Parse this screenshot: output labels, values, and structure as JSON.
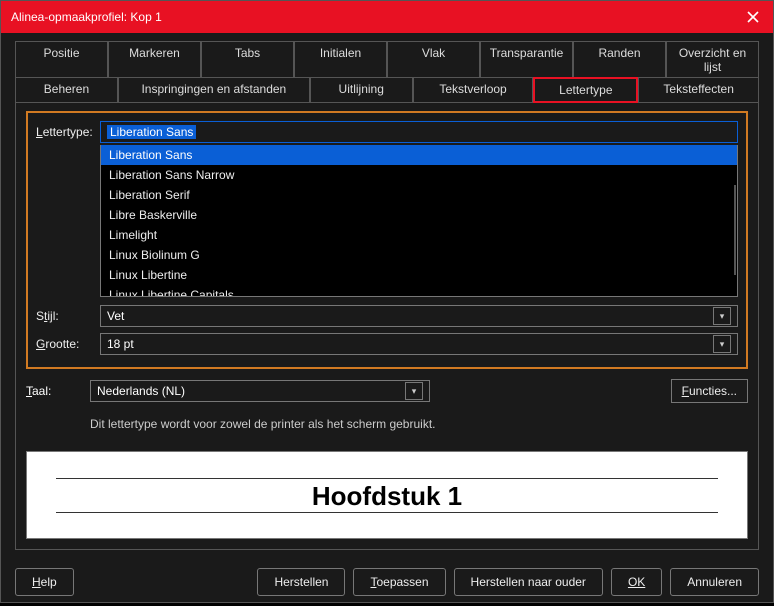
{
  "title": "Alinea-opmaakprofiel: Kop 1",
  "tabs1": {
    "positie": "Positie",
    "markeren": "Markeren",
    "tabs": "Tabs",
    "initialen": "Initialen",
    "vlak": "Vlak",
    "transparantie": "Transparantie",
    "randen": "Randen",
    "overzicht": "Overzicht en lijst"
  },
  "tabs2": {
    "beheren": "Beheren",
    "inspring": "Inspringingen en afstanden",
    "uitlijning": "Uitlijning",
    "tekstverloop": "Tekstverloop",
    "lettertype": "Lettertype",
    "teksteffecten": "Teksteffecten"
  },
  "labels": {
    "lettertype": "Lettertype:",
    "stijl": "Stijl:",
    "grootte": "Grootte:",
    "taal": "Taal:"
  },
  "font": {
    "name": "Liberation Sans",
    "list": {
      "i0": "Liberation Sans",
      "i1": "Liberation Sans Narrow",
      "i2": "Liberation Serif",
      "i3": "Libre Baskerville",
      "i4": "Limelight",
      "i5": "Linux Biolinum G",
      "i6": "Linux Libertine",
      "i7": "Linux Libertine Capitals"
    }
  },
  "style": "Vet",
  "size": "18 pt",
  "lang": "Nederlands (NL)",
  "functies": "Functies...",
  "hint": "Dit lettertype wordt voor zowel de printer als het scherm gebruikt.",
  "preview": "Hoofdstuk 1",
  "buttons": {
    "help": "Help",
    "herstellen": "Herstellen",
    "toepassen": "Toepassen",
    "naarouder": "Herstellen naar ouder",
    "ok": "OK",
    "annuleren": "Annuleren"
  }
}
